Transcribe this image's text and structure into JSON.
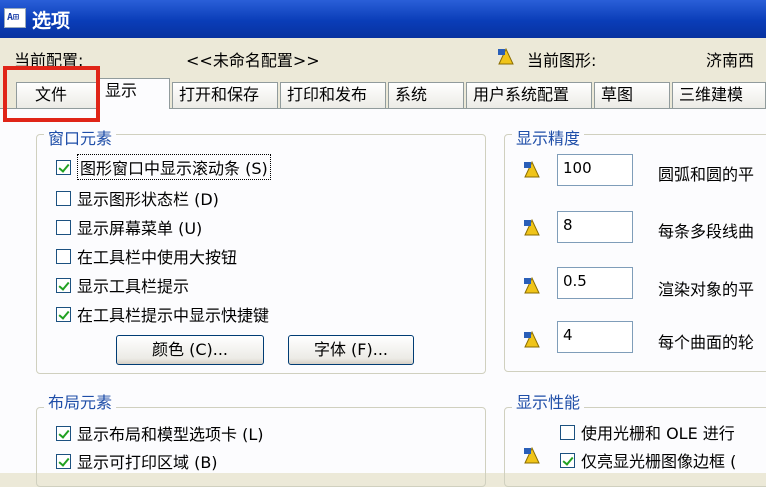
{
  "window": {
    "title": "选项",
    "app_icon_text": "A⊞"
  },
  "config": {
    "current_config_label": "当前配置:",
    "current_config_value": "<<未命名配置>>",
    "current_drawing_label": "当前图形:",
    "current_drawing_value": "济南西"
  },
  "tabs": [
    "文件",
    "显示",
    "打开和保存",
    "打印和发布",
    "系统",
    "用户系统配置",
    "草图",
    "三维建模"
  ],
  "active_tab": "显示",
  "window_elements": {
    "title": "窗口元素",
    "checkboxes": [
      {
        "label": "图形窗口中显示滚动条 (S)",
        "checked": true
      },
      {
        "label": "显示图形状态栏 (D)",
        "checked": false
      },
      {
        "label": "显示屏幕菜单 (U)",
        "checked": false
      },
      {
        "label": "在工具栏中使用大按钮",
        "checked": false
      },
      {
        "label": "显示工具栏提示",
        "checked": true
      },
      {
        "label": "在工具栏提示中显示快捷键",
        "checked": true
      }
    ],
    "colors_button": "颜色 (C)...",
    "fonts_button": "字体 (F)..."
  },
  "layout_elements": {
    "title": "布局元素",
    "checkboxes": [
      {
        "label": "显示布局和模型选项卡 (L)",
        "checked": true
      },
      {
        "label": "显示可打印区域 (B)",
        "checked": true
      }
    ]
  },
  "display_resolution": {
    "title": "显示精度",
    "items": [
      {
        "value": "100",
        "label": "圆弧和圆的平"
      },
      {
        "value": "8",
        "label": "每条多段线曲"
      },
      {
        "value": "0.5",
        "label": "渲染对象的平"
      },
      {
        "value": "4",
        "label": "每个曲面的轮"
      }
    ]
  },
  "display_performance": {
    "title": "显示性能",
    "checkboxes": [
      {
        "label": "使用光栅和 OLE 进行",
        "checked": false
      },
      {
        "label": "仅亮显光栅图像边框 (",
        "checked": true
      }
    ]
  },
  "colors": {
    "title_bar": "#0a3db8",
    "group_title": "#1f4ea8",
    "highlight_box": "#e02518"
  }
}
